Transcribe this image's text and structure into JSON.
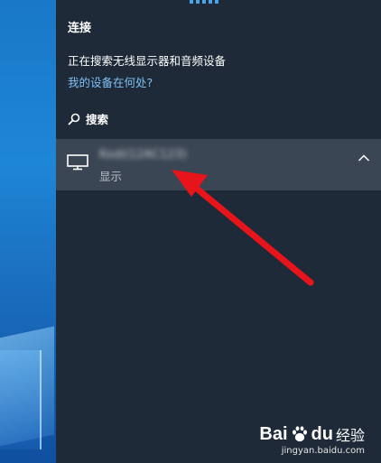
{
  "panel": {
    "title": "连接",
    "status_text": "正在搜索无线显示器和音频设备",
    "help_link": "我的设备在何处?",
    "search_label": "搜索"
  },
  "device": {
    "name": "Kodi(12AC123)",
    "type_label": "显示"
  },
  "watermark": {
    "logo_a": "Bai",
    "logo_b": "du",
    "logo_cn": "经验",
    "url": "jingyan.baidu.com"
  },
  "colors": {
    "panel_bg": "#1f2a38",
    "device_row_bg": "#3a4653",
    "link": "#7ec0f5",
    "accent_dots": "#4aa3e8",
    "arrow": "#e8141b"
  },
  "icons": {
    "search": "search-icon",
    "monitor": "monitor-icon",
    "chevron": "chevron-up-icon"
  }
}
